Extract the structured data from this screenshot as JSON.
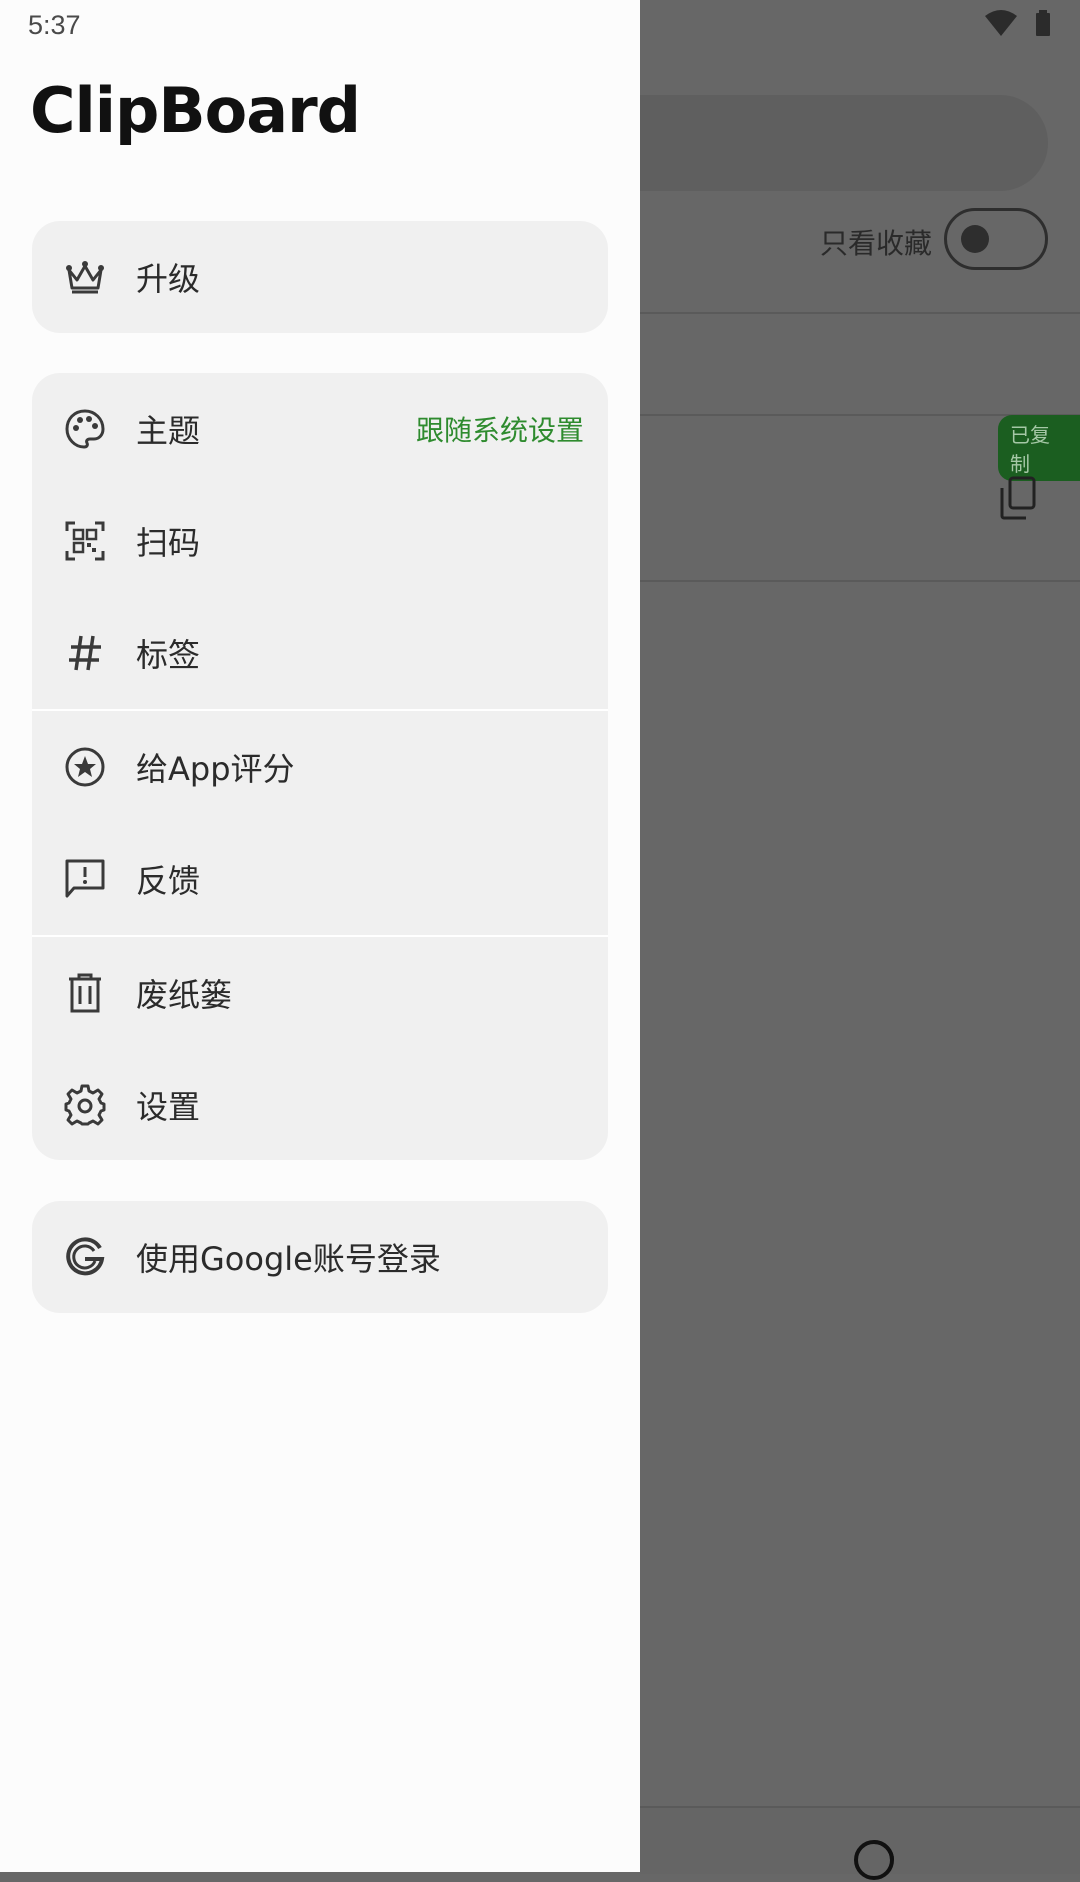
{
  "status_bar": {
    "time": "5:37"
  },
  "app": {
    "title": "ClipBoard"
  },
  "background": {
    "favorites_label": "只看收藏",
    "copied_badge": "已复制"
  },
  "drawer": {
    "upgrade": {
      "label": "升级",
      "icon": "crown-icon"
    },
    "menu": [
      {
        "label": "主题",
        "value": "跟随系统设置",
        "icon": "palette-icon"
      },
      {
        "label": "扫码",
        "icon": "qr-scan-icon"
      },
      {
        "label": "标签",
        "icon": "hashtag-icon"
      },
      {
        "label": "给App评分",
        "icon": "star-circle-icon"
      },
      {
        "label": "反馈",
        "icon": "feedback-icon"
      },
      {
        "label": "废纸篓",
        "icon": "trash-icon"
      },
      {
        "label": "设置",
        "icon": "gear-icon"
      }
    ],
    "google_login": {
      "label": "使用Google账号登录",
      "icon": "google-icon"
    }
  },
  "colors": {
    "accent_green": "#2e8b2e",
    "drawer_bg": "#fcfcfc",
    "card_bg": "#f0f0f0",
    "scrim": "#676767"
  }
}
